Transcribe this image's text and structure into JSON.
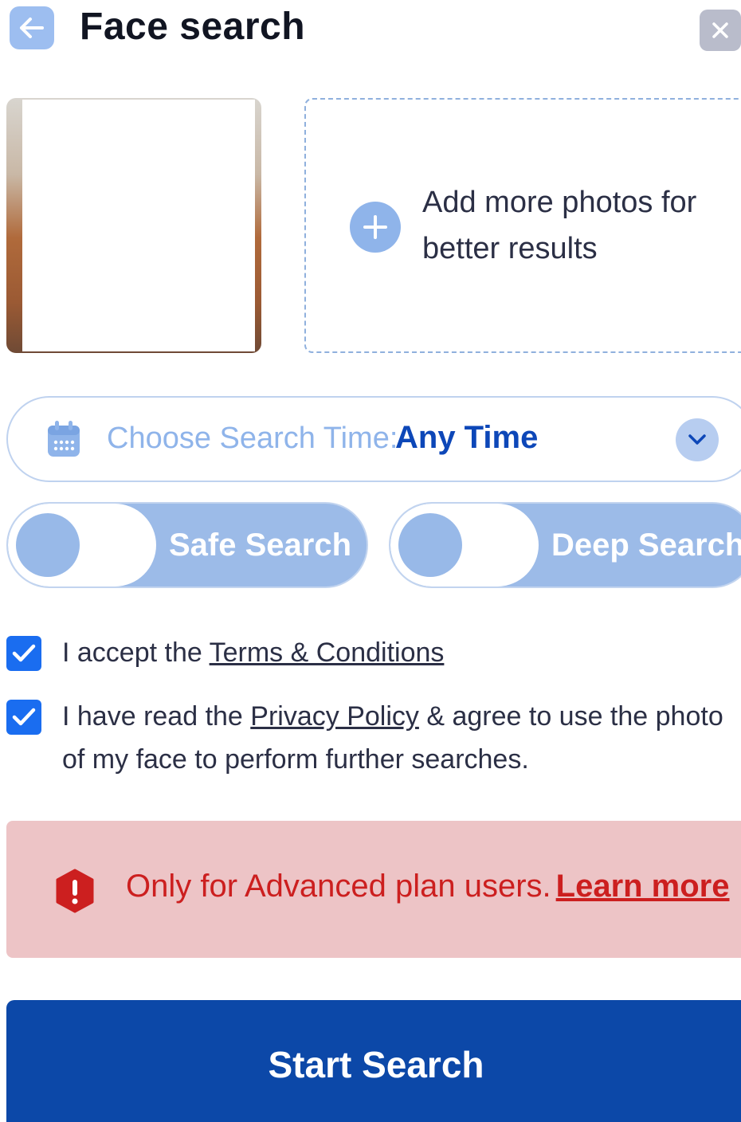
{
  "header": {
    "title": "Face search",
    "back_icon": "arrow-left-icon",
    "close_icon": "close-icon"
  },
  "photos": {
    "add_more_text": "Add more photos for better results",
    "add_icon": "plus-icon"
  },
  "search_time": {
    "label": "Choose Search Time:",
    "value": "Any Time",
    "icon": "calendar-icon"
  },
  "toggles": {
    "safe_search": "Safe Search",
    "deep_search": "Deep Search"
  },
  "consent": {
    "terms_prefix": "I accept the ",
    "terms_link": "Terms & Conditions",
    "privacy_prefix": "I have read the ",
    "privacy_link": "Privacy Policy",
    "privacy_suffix": " & agree to use the photo of my face to perform further searches."
  },
  "alert": {
    "text": "Only for Advanced plan users.",
    "link": "Learn more"
  },
  "actions": {
    "start_search": "Start Search"
  },
  "colors": {
    "primary": "#0c48a8",
    "accent_light": "#9dbef0",
    "checkbox": "#1a6df0",
    "alert_bg": "#edc4c6",
    "alert_text": "#cc1f1f"
  }
}
